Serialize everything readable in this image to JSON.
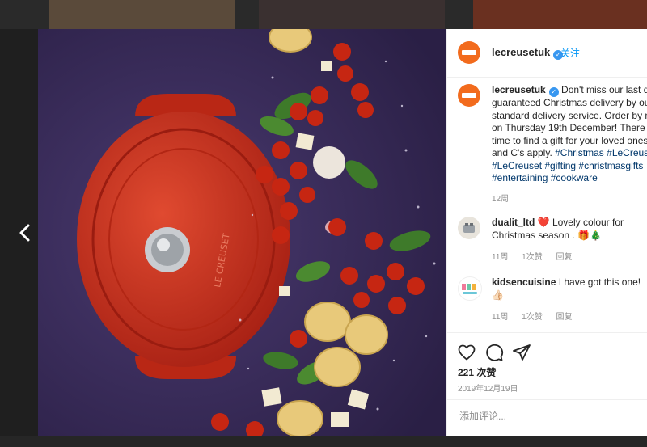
{
  "post": {
    "username": "lecreusetuk",
    "follow_label": "关注",
    "caption_user": "lecreusetuk",
    "caption_text": "Don't miss our last day\nguaranteed Christmas delivery by our\nstandard delivery service. Order by no\non Thursday 19th December! There is\ntime to find a gift for your loved ones!\nand C's apply. ",
    "caption_tags": "#Christmas #LeCreuset\n#LeCreuset #gifting #christmasgifts\n#entertaining #cookware",
    "caption_time": "12周",
    "comments": [
      {
        "user": "dualit_ltd",
        "text": " ❤️ Lovely colour for\nChristmas season . 🎁🎄",
        "time": "11周",
        "likes": "1次赞",
        "reply": "回复"
      },
      {
        "user": "kidsencuisine",
        "text": " I have got this one!\n👍🏻",
        "time": "11周",
        "likes": "1次赞",
        "reply": "回复"
      }
    ],
    "like_count": "221 次赞",
    "date": "2019年12月19日",
    "comment_placeholder": "添加评论...",
    "icons": [
      "heart-icon",
      "comment-icon",
      "share-icon",
      "chevron-left-icon",
      "verified-icon"
    ],
    "colors": {
      "accent": "#f26b1d",
      "link": "#00376b",
      "follow": "#0095f6",
      "pot": "#c7311f"
    }
  }
}
